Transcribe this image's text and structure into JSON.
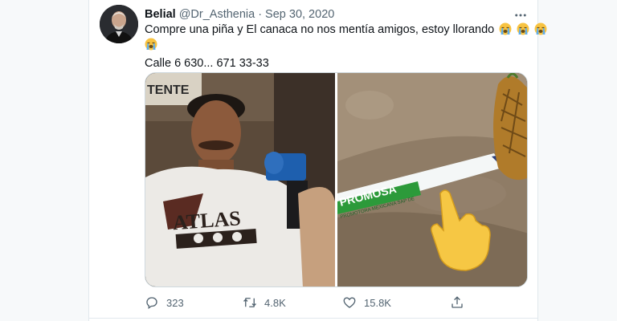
{
  "tweet": {
    "author": {
      "display_name": "Belial",
      "handle": "@Dr_Asthenia",
      "separator": "·",
      "date": "Sep 30, 2020"
    },
    "text": {
      "line1": "Compre una piña y El canaca no nos mentía amigos, estoy llorando",
      "line3": "Calle 6 630... 671 33-33"
    },
    "emoji": "loudly-crying-face",
    "media": {
      "left_image": {
        "shirt_text": "ATLAS",
        "banner_text": "TENTE"
      },
      "right_image": {
        "wristband_brand": "PROMOSA",
        "wristband_subtitle": "PROMOTORA MEXICANA SAP DE"
      }
    },
    "actions": {
      "reply_count": "323",
      "retweet_count": "4.8K",
      "like_count": "15.8K"
    }
  }
}
